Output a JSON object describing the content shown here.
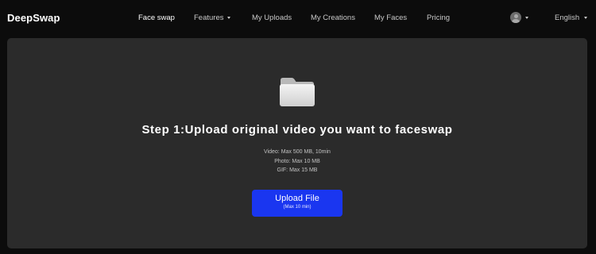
{
  "header": {
    "logo": "DeepSwap",
    "nav": [
      {
        "label": "Face swap"
      },
      {
        "label": "Features"
      },
      {
        "label": "My Uploads"
      },
      {
        "label": "My Creations"
      },
      {
        "label": "My Faces"
      },
      {
        "label": "Pricing"
      }
    ],
    "avatar_icon": "user-avatar-icon",
    "language": "English"
  },
  "upload": {
    "icon": "folder-icon",
    "title": "Step 1:Upload original video you want to faceswap",
    "limits": [
      "Video: Max 500 MB, 10min",
      "Photo: Max 10 MB",
      "GIF: Max 15 MB"
    ],
    "button_label": "Upload File",
    "button_sublabel": "(Max 10 min)"
  },
  "colors": {
    "background": "#0c0c0c",
    "panel": "#2b2b2b",
    "accent": "#1a36f0"
  }
}
